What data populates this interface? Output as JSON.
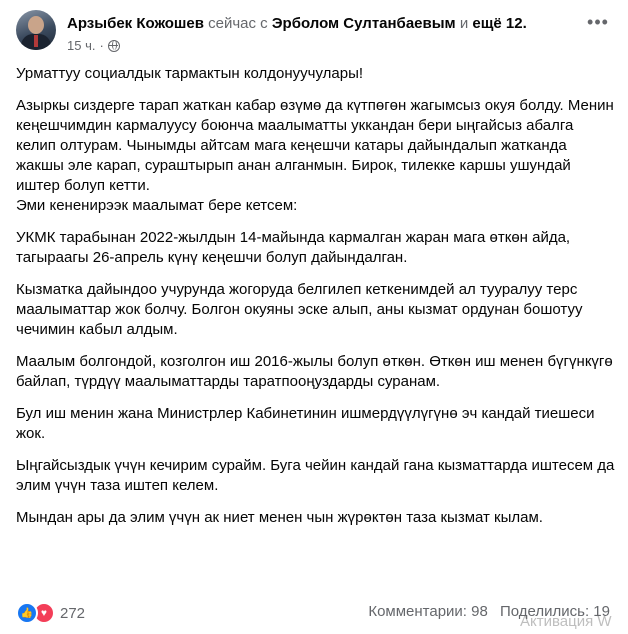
{
  "post": {
    "author": "Арзыбек Кожошев",
    "time_prefix": "сейчас с",
    "tagged": "Эрболом Султанбаевым",
    "and_word": "и",
    "others": "ещё 12.",
    "timestamp": "15 ч.",
    "dot": "·",
    "more_icon": "more-horizontal-icon",
    "privacy_icon": "globe-icon"
  },
  "paragraphs": [
    "Урматтуу  социалдык тармактын колдонуучулары!",
    "Азыркы сиздерге тарап жаткан кабар өзүмө да күтпөгөн жагымсыз окуя болду. Менин кеңешчимдин кармалуусу боюнча маалыматты уккандан бери  ыңгайсыз абалга келип олтурам. Чынымды айтсам  мага кеңешчи катары дайындалып жатканда жакшы эле карап, сураштырып анан алганмын.  Бирок,  тилекке каршы ушундай иштер болуп кетти.\nЭми кененирээк маалымат бере кетсем:",
    "УКМК тарабынан 2022-жылдын 14-майында кармалган жаран мага өткөн айда, тагыраагы 26-апрель күнү кеңешчи болуп дайындалган.",
    "Кызматка дайындоо учурунда жогоруда белгилеп кеткенимдей ал тууралуу терс маалыматтар жок болчу. Болгон окуяны эске алып,   аны кызмат ордунан бошотуу чечимин кабыл алдым.",
    "Маалым болгондой, козголгон иш 2016-жылы болуп өткөн.  Өткөн  иш менен бүгүнкүгө байлап, түрдүү маалыматтарды таратпооңуздарды суранам.",
    "Бул иш менин жана Министрлер Кабинетинин ишмердүүлүгүнө эч кандай тиешеси жок.",
    "Ыңгайсыздык үчүн кечирим сурайм.  Буга чейин кандай гана кызматтарда иштесем да элим үчүн таза иштеп келем.",
    "Мындан ары да элим үчүн ак ниет менен чын жүрөктөн таза кызмат кылам."
  ],
  "footer": {
    "reaction_icons": [
      "like-icon",
      "love-icon"
    ],
    "reaction_count": "272",
    "comments": "Комментарии: 98",
    "shares": "Поделились: 19"
  },
  "watermark": "Активация W"
}
